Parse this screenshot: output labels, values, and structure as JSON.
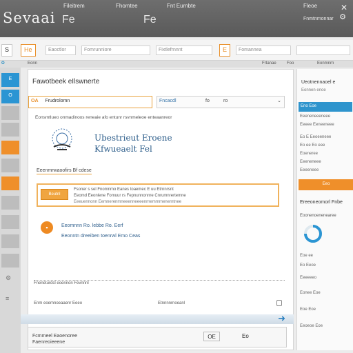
{
  "titlebar": {
    "brand": "Sevaai",
    "menu": [
      "Fileitrem",
      "Fhomtee",
      "Fnt Eurnbte"
    ],
    "sub": [
      "Fe",
      "Fe"
    ],
    "right_label": "Fleoe",
    "right_sub": "Fnmtnmonnar"
  },
  "toolbar": {
    "btn_s": "S",
    "btn_he": "He",
    "input1": "Eaoctlor",
    "input2": "Fomrunniore",
    "input3": "Fixtlefrnnnt",
    "btn_e": "E",
    "input4": "Fomannea"
  },
  "strip": {
    "label": "O",
    "items": [
      "Eonn",
      "Frtanae",
      "Foo",
      "Eonmnrn"
    ]
  },
  "leftbar": {
    "tiles": [
      "E",
      "O",
      "",
      "",
      "",
      "",
      ""
    ]
  },
  "main": {
    "title": "Fawotbeek eIlswnerte",
    "select_tag": "OA",
    "select_text": "Frudrolomn",
    "select_right": "Fncacdl",
    "select_p1": "fo",
    "select_p2": "ro",
    "description": "Eonsmtlueo onmadinoos reneaie afo entunr rsvnmeleoe enteaanreor",
    "logo_heading1": "Ubestrieut Eroene",
    "logo_heading2": "Kfwueaelt Fel",
    "section_label": "Eeenmrwaoofirs Bf cdese",
    "orange_button": "Beutnl",
    "line1": "Fsoner s  sel Fnomnmo Eanes toaemec E  uu  Etrnnrsnt",
    "line2": "Eeomd Eeonlene Fomuur rs Fepnunnonnre Cnrumnrertemne",
    "line3": "Eeeuennonn Eemnerenmneeenneeeenrnemmrnenerntnee",
    "item_line1": "Eeomnnn Ro. lebbe Ro. Eerf",
    "item_line2": "Eeonntn dreeiben toenrwl Emo Ceas",
    "footer_sep": "Fneneturdcl eoennon Fevnnnl",
    "footer_left": "Enm eoemnoeaaenr  Eeeo",
    "footer_right": "Etnnnnrnoeanl"
  },
  "bottom": {
    "status_left": "Fcmmeel Eaoenoree Faenreoieeene",
    "status_mid": "OE",
    "status_right": "Eo"
  },
  "rpanel": {
    "title": "Ueotnennaoel e",
    "subtitle": "Eonnen enoe",
    "tab": "Eno  Eoe",
    "rows": [
      "Eeeneneeeneee",
      "Eeeee Eeneeneee",
      "Eo E Eeoeeneee",
      "Eo ee Eo eee",
      "Eoeneree",
      "Eeeneneee",
      "Eeeeneee"
    ],
    "orange_btn": "Eeo",
    "heading": "Ereeoneomorl Fnbe",
    "heading2": "Eoonenoenenearee",
    "progress_rows": [
      "Eoe  ee",
      "Eo  Eeoe",
      "Eeeeeeo",
      "Eonee  Eoe",
      "Eoe  Eoe",
      "Eeoeoe Eoe"
    ]
  },
  "colors": {
    "accent_orange": "#ef8f2a",
    "accent_blue": "#2b95d3",
    "title_gray": "#5e5e5e"
  }
}
